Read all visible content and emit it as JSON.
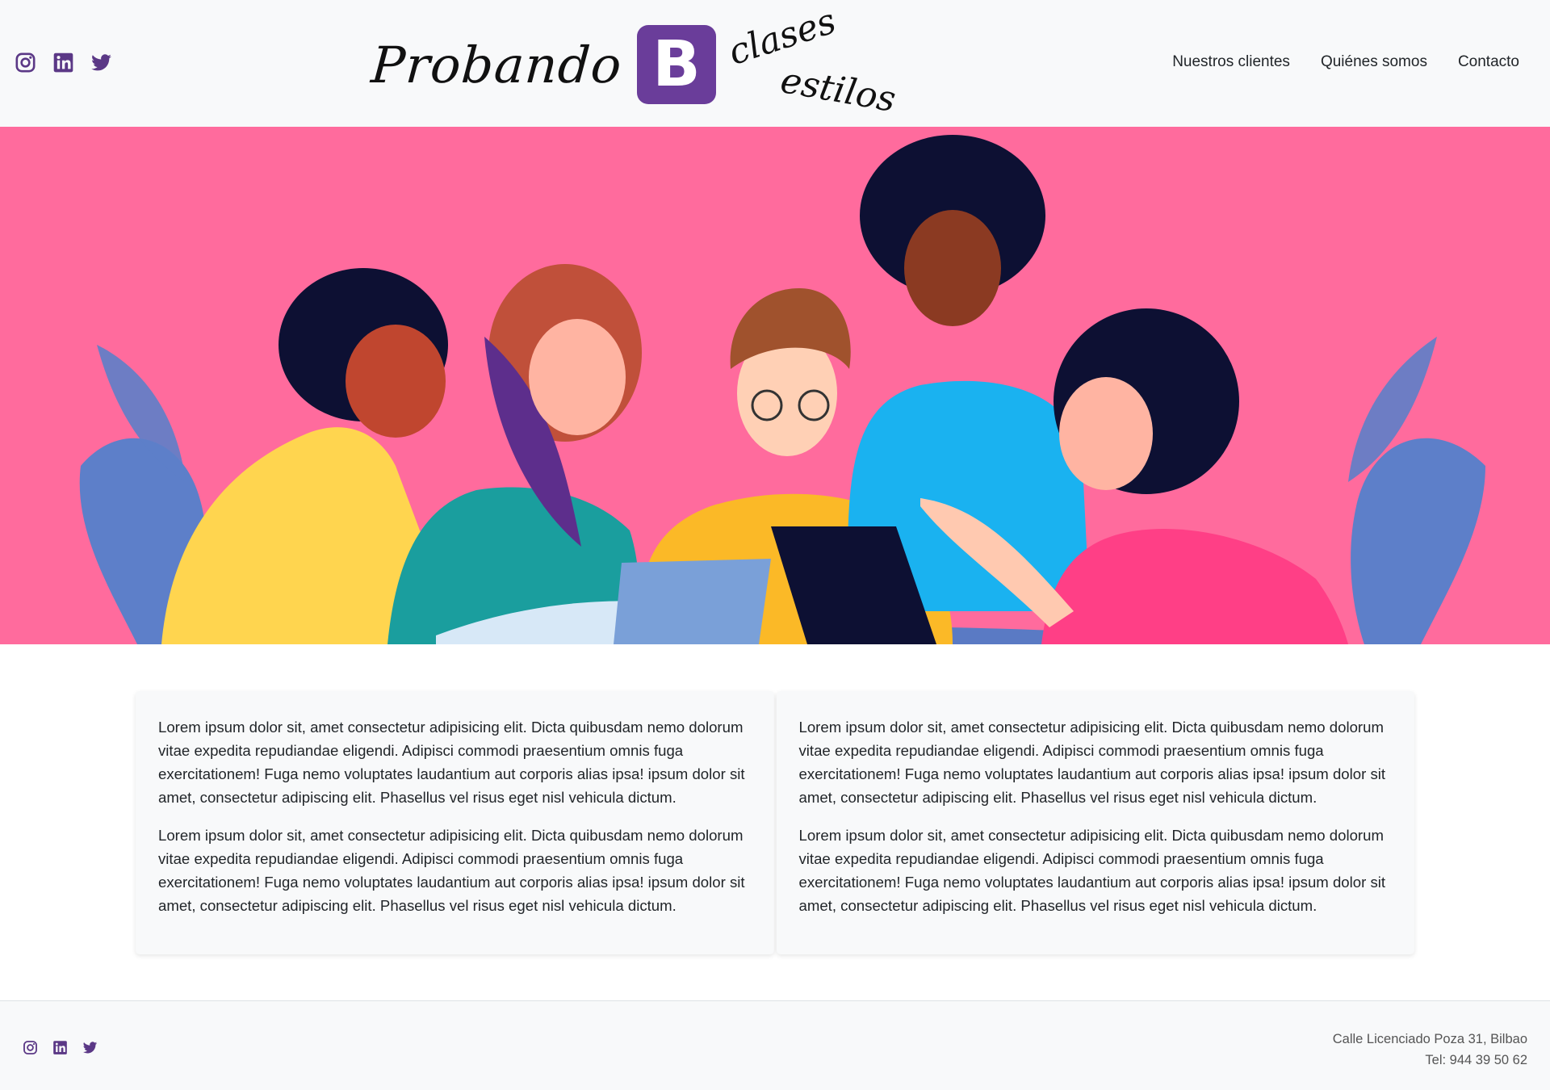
{
  "header": {
    "social_icons": [
      "instagram-icon",
      "linkedin-icon",
      "twitter-icon"
    ],
    "logo": {
      "word": "Probando",
      "letter": "B",
      "sub1": "clases",
      "sub2": "estilos"
    },
    "nav": [
      "Nuestros clientes",
      "Quiénes somos",
      "Contacto"
    ]
  },
  "hero": {
    "image": "Illustration of five people studying together around a laptop on a pink background"
  },
  "cards": [
    {
      "paragraphs": [
        "Lorem ipsum dolor sit, amet consectetur adipisicing elit. Dicta quibusdam nemo dolorum vitae expedita repudiandae eligendi. Adipisci commodi praesentium omnis fuga exercitationem! Fuga nemo voluptates laudantium aut corporis alias ipsa! ipsum dolor sit amet, consectetur adipiscing elit. Phasellus vel risus eget nisl vehicula dictum.",
        "Lorem ipsum dolor sit, amet consectetur adipisicing elit. Dicta quibusdam nemo dolorum vitae expedita repudiandae eligendi. Adipisci commodi praesentium omnis fuga exercitationem! Fuga nemo voluptates laudantium aut corporis alias ipsa! ipsum dolor sit amet, consectetur adipiscing elit. Phasellus vel risus eget nisl vehicula dictum."
      ]
    },
    {
      "paragraphs": [
        "Lorem ipsum dolor sit, amet consectetur adipisicing elit. Dicta quibusdam nemo dolorum vitae expedita repudiandae eligendi. Adipisci commodi praesentium omnis fuga exercitationem! Fuga nemo voluptates laudantium aut corporis alias ipsa! ipsum dolor sit amet, consectetur adipiscing elit. Phasellus vel risus eget nisl vehicula dictum.",
        "Lorem ipsum dolor sit, amet consectetur adipisicing elit. Dicta quibusdam nemo dolorum vitae expedita repudiandae eligendi. Adipisci commodi praesentium omnis fuga exercitationem! Fuga nemo voluptates laudantium aut corporis alias ipsa! ipsum dolor sit amet, consectetur adipiscing elit. Phasellus vel risus eget nisl vehicula dictum."
      ]
    }
  ],
  "footer": {
    "social_icons": [
      "instagram-icon",
      "linkedin-icon",
      "twitter-icon"
    ],
    "address": "Calle Licenciado Poza 31, Bilbao",
    "phone": "Tel: 944 39 50 62"
  },
  "colors": {
    "accent": "#5b3886",
    "logo_bg": "#6a3d9a",
    "hero_bg": "#ff6b9d",
    "header_bg": "#f8f9fa"
  }
}
